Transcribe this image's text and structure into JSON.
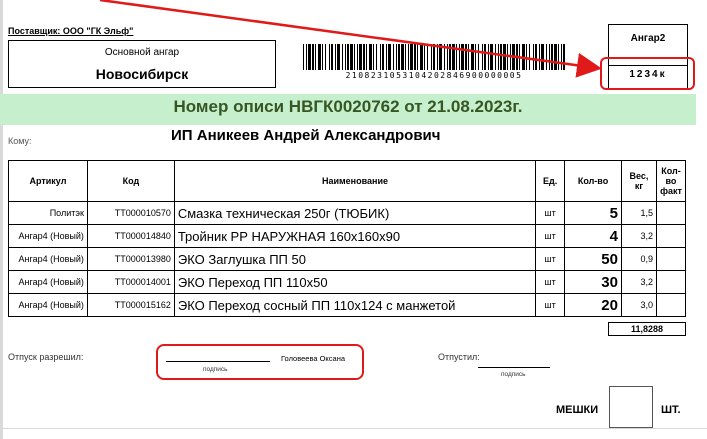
{
  "supplier": "Поставщик: ООО \"ГК Эльф\"",
  "warehouse": {
    "label": "Основной ангар",
    "city": "Новосибирск"
  },
  "barcode_digits": "2108231053104202846900000005",
  "hangar": {
    "title": "Ангар2",
    "code": "1234к"
  },
  "doc_title": "Номер описи НВГК0020762  от 21.08.2023г.",
  "recipient": {
    "label": "Кому:",
    "name": "ИП Аникеев Андрей Александрович"
  },
  "table": {
    "headers": [
      "Артикул",
      "Код",
      "Наименование",
      "Ед.",
      "Кол-во",
      "Вес, кг",
      "Кол-во факт"
    ],
    "rows": [
      {
        "article": "Политэк",
        "code": "ТТ000010570",
        "name": "Смазка техническая 250г (ТЮБИК)",
        "unit": "шт",
        "qty": "5",
        "weight": "1,5",
        "fact": ""
      },
      {
        "article": "Ангар4 (Новый)",
        "code": "ТТ000014840",
        "name": "Тройник РР НАРУЖНАЯ 160х160х90",
        "unit": "шт",
        "qty": "4",
        "weight": "3,2",
        "fact": ""
      },
      {
        "article": "Ангар4 (Новый)",
        "code": "ТТ000013980",
        "name": "ЭКО Заглушка ПП 50",
        "unit": "шт",
        "qty": "50",
        "weight": "0,9",
        "fact": ""
      },
      {
        "article": "Ангар4 (Новый)",
        "code": "ТТ000014001",
        "name": "ЭКО Переход ПП 110х50",
        "unit": "шт",
        "qty": "30",
        "weight": "3,2",
        "fact": ""
      },
      {
        "article": "Ангар4 (Новый)",
        "code": "ТТ000015162",
        "name": "ЭКО Переход сосный ПП 110х124 с манжетой",
        "unit": "шт",
        "qty": "20",
        "weight": "3,0",
        "fact": ""
      }
    ]
  },
  "total_weight": "11,8288",
  "release": {
    "label": "Отпуск разрешил:",
    "name": "Головеева Оксана",
    "sign_caption": "подпись"
  },
  "dispatch": {
    "label": "Отпустил:",
    "sign_caption": "подпись"
  },
  "bags": {
    "label": "МЕШКИ",
    "unit": "ШТ."
  },
  "colors": {
    "annotation_red": "#e01a1a",
    "banner_bg": "#c6efce",
    "banner_text": "#375623"
  }
}
